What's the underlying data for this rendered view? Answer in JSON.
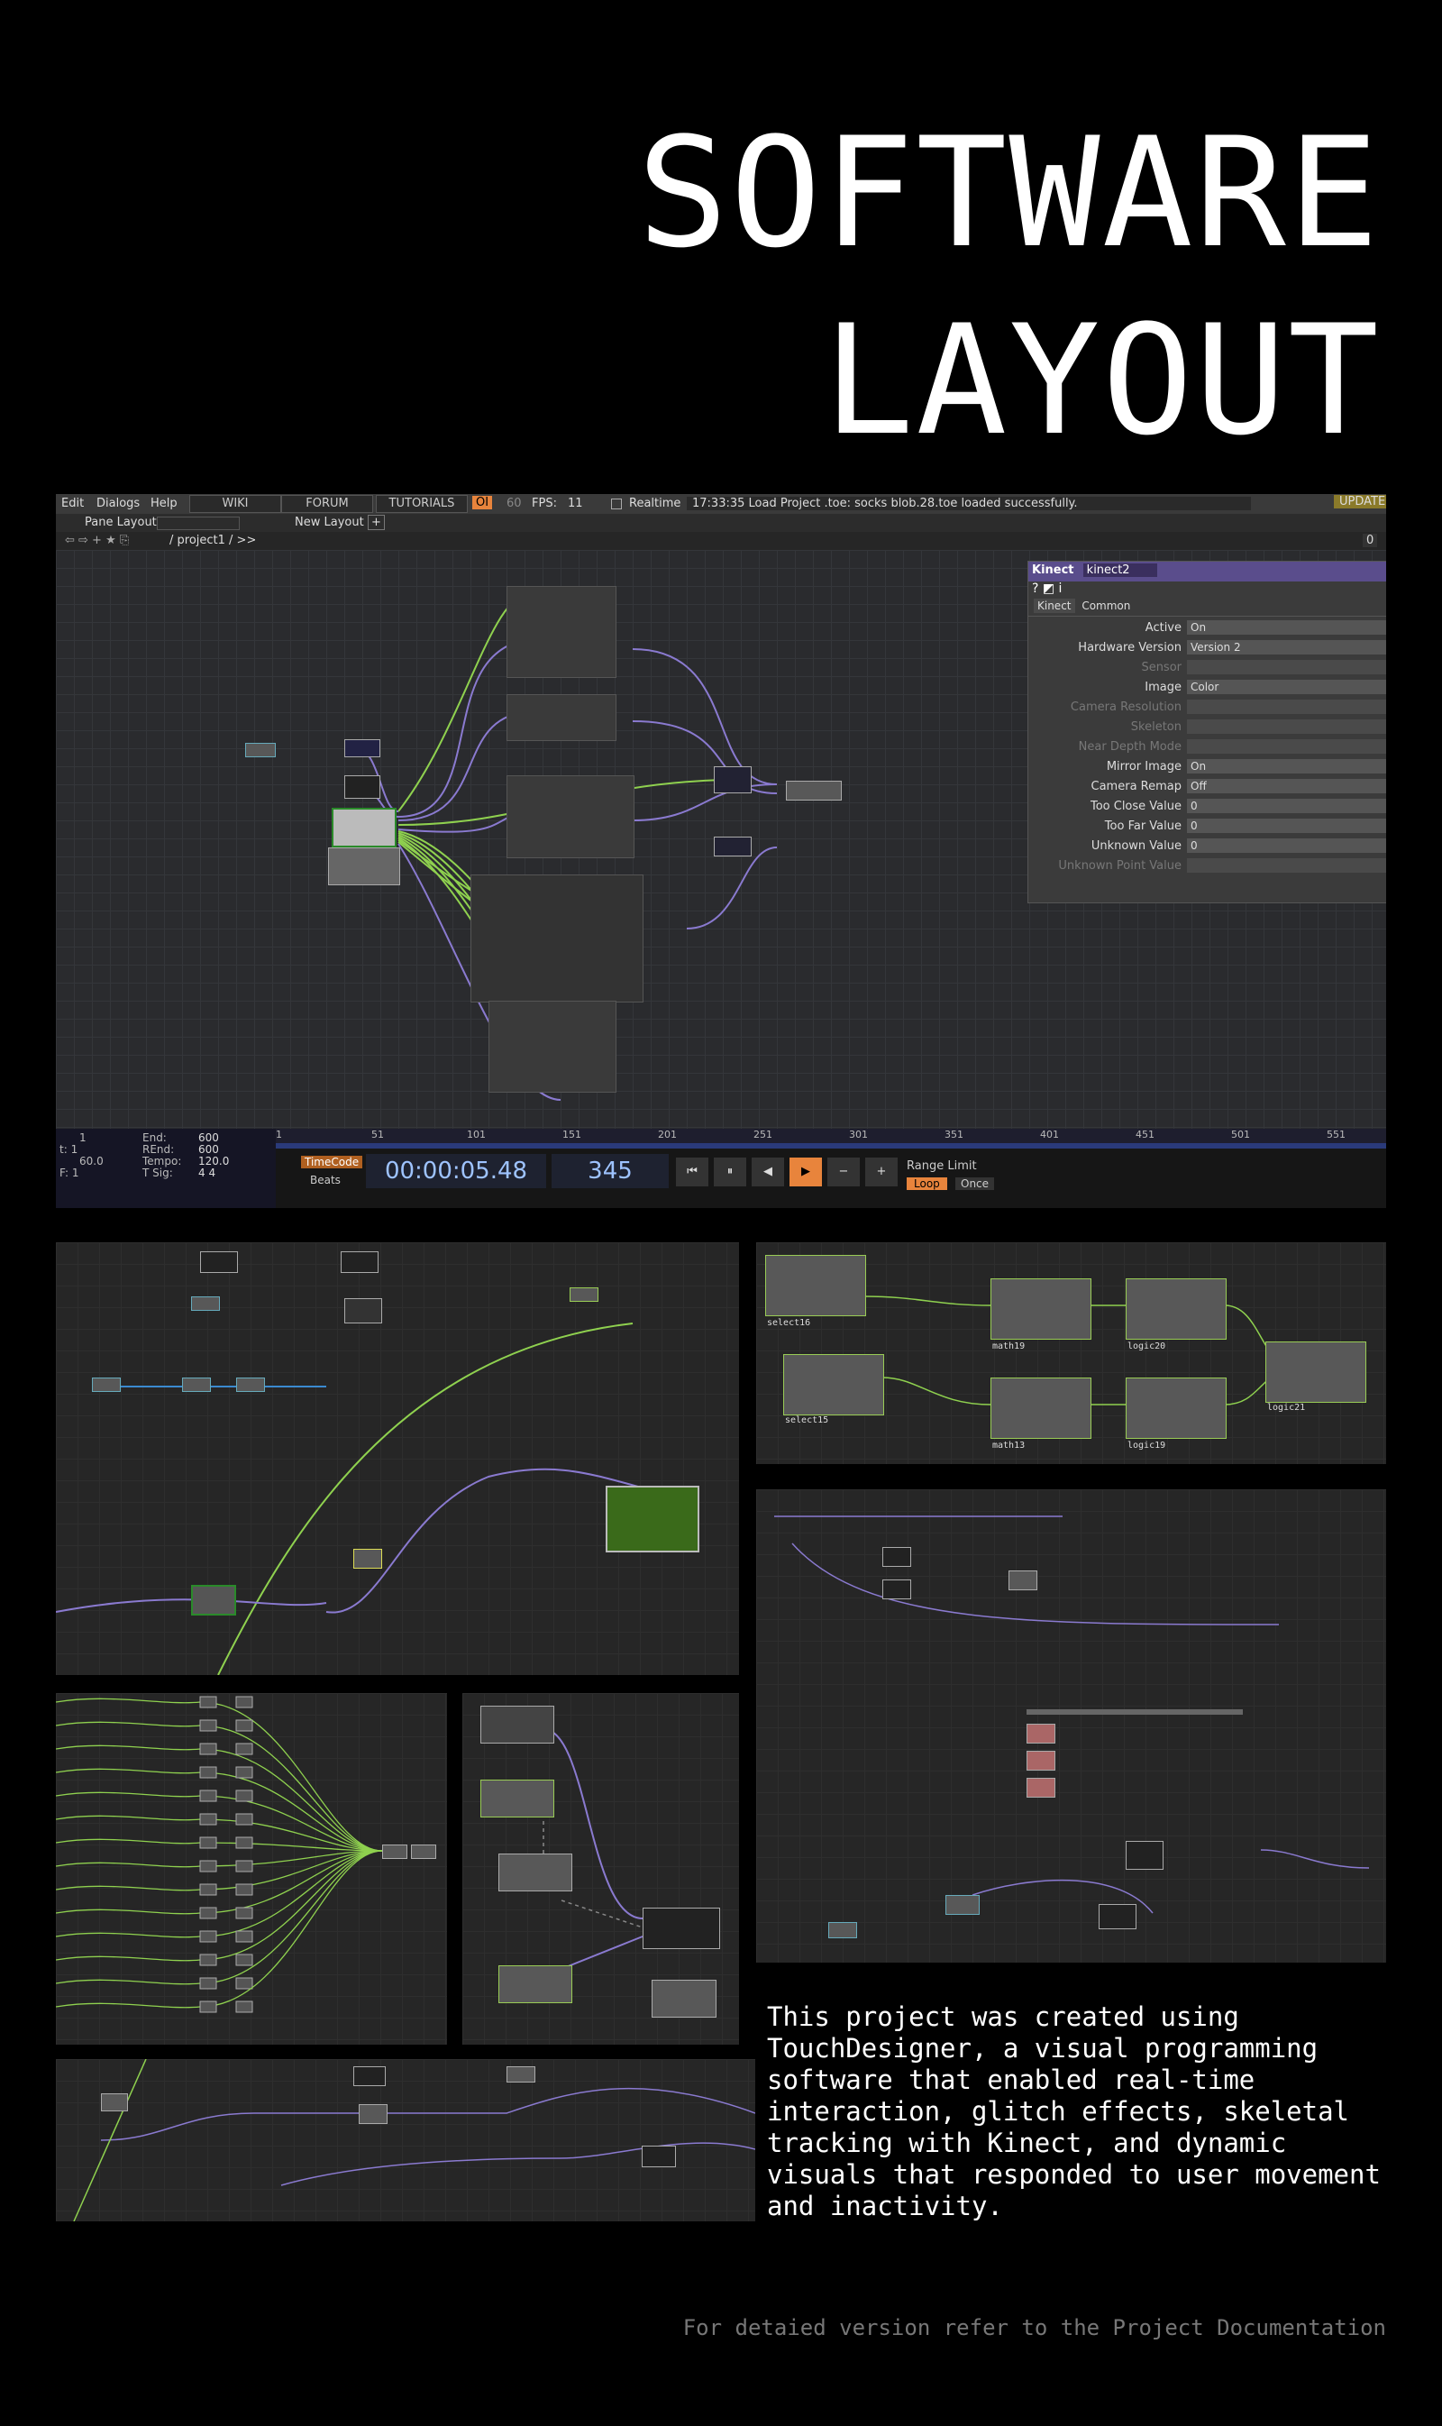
{
  "title_lines": [
    "SOFTWARE",
    "LAYOUT"
  ],
  "td": {
    "menu": [
      "Edit",
      "Dialogs",
      "Help"
    ],
    "menu_buttons": [
      "WIKI",
      "FORUM",
      "TUTORIALS"
    ],
    "oi": "OI",
    "sixty": "60",
    "fps_label": "FPS:",
    "fps_value": "11",
    "realtime": "Realtime",
    "status": "17:33:35 Load Project .toe: socks blob.28.toe loaded successfully.",
    "update": "UPDATE",
    "pane_layout": "Pane Layout",
    "new_layout": "New Layout",
    "plus": "+",
    "path": "/ project1 / >>",
    "zero": "0"
  },
  "param": {
    "type": "Kinect",
    "name": "kinect2",
    "tabs": [
      "Kinect",
      "Common"
    ],
    "rows": [
      {
        "label": "Active",
        "value": "On"
      },
      {
        "label": "Hardware Version",
        "value": "Version 2"
      },
      {
        "label": "Sensor",
        "value": ""
      },
      {
        "label": "Image",
        "value": "Color"
      },
      {
        "label": "Camera Resolution",
        "value": ""
      },
      {
        "label": "Skeleton",
        "value": ""
      },
      {
        "label": "Near Depth Mode",
        "value": ""
      },
      {
        "label": "Mirror Image",
        "value": "On"
      },
      {
        "label": "Camera Remap",
        "value": "Off"
      },
      {
        "label": "Too Close Value",
        "value": "0"
      },
      {
        "label": "Too Far Value",
        "value": "0"
      },
      {
        "label": "Unknown Value",
        "value": "0"
      },
      {
        "label": "Unknown Point Value",
        "value": ""
      }
    ]
  },
  "timeline": {
    "left_labels": [
      "1",
      "t:  1",
      "60.0",
      "F:  1"
    ],
    "right_labels": [
      "End:",
      "REnd:",
      "Tempo:",
      "T Sig:"
    ],
    "right_values": [
      "600",
      "600",
      "120.0",
      "4    4"
    ],
    "ticks": [
      "1",
      "51",
      "101",
      "151",
      "201",
      "251",
      "301",
      "351",
      "401",
      "451",
      "501",
      "551"
    ],
    "timecode_btn": "TimeCode",
    "beats_btn": "Beats",
    "timecode": "00:00:05.48",
    "frame": "345",
    "range_limit": "Range Limit",
    "loop": "Loop",
    "once": "Once"
  },
  "node_labels": {
    "math13": "math13",
    "math19": "math19",
    "logic20": "logic20",
    "logic19": "logic19",
    "logic21": "logic21",
    "select16": "select16",
    "select15": "select15"
  },
  "description": "This project was created using\nTouchDesigner, a visual programming\nsoftware that enabled real-time\ninteraction, glitch effects, skeletal\ntracking with Kinect, and dynamic\nvisuals that responded to user movement\nand inactivity.",
  "footer": "For detaied version refer to the Project Documentation",
  "colors": {
    "accent": "#e8843c",
    "param_header": "#5a4d8c",
    "wire_green": "#8fd14f",
    "wire_purple": "#8a7ad0"
  }
}
